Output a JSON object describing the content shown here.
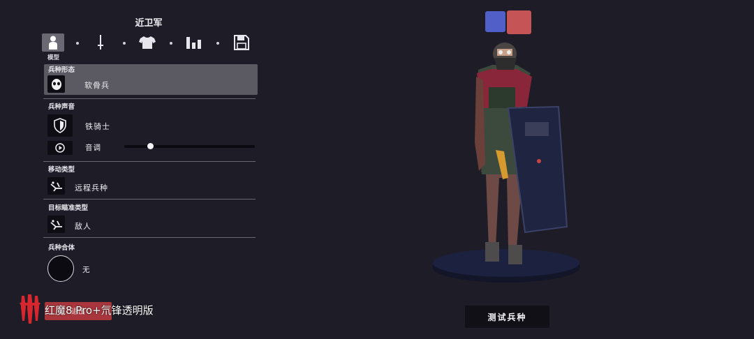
{
  "header": {
    "title": "近卫军"
  },
  "toolbar": {
    "tabs": [
      {
        "icon": "person-icon",
        "label": "模型"
      },
      {
        "icon": "sword-icon"
      },
      {
        "icon": "shirt-icon"
      },
      {
        "icon": "stats-icon"
      },
      {
        "icon": "save-icon"
      }
    ],
    "active_label": "模型"
  },
  "sections": {
    "form": {
      "label": "兵种形态",
      "value": "软骨兵",
      "icon": "mask-icon"
    },
    "voice": {
      "label": "兵种声音",
      "value": "铁骑士",
      "icon": "shield-icon",
      "pitch_label": "音调",
      "pitch_level": 0.2
    },
    "movement": {
      "label": "移动类型",
      "value": "远程兵种",
      "icon": "ranged-icon"
    },
    "target": {
      "label": "目标瞄准类型",
      "value": "敌人",
      "icon": "target-icon"
    },
    "merge": {
      "label": "兵种合体",
      "value": "无"
    }
  },
  "team_colors": {
    "blue": "#5060c8",
    "red": "#c45456"
  },
  "actions": {
    "test_unit": "测试兵种",
    "red_button": "退出"
  },
  "watermark": {
    "text": "红魔8 Pro+氘锋透明版"
  }
}
